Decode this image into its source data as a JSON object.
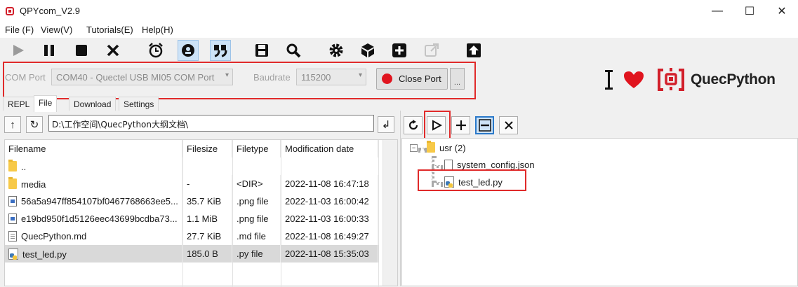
{
  "window": {
    "title": "QPYcom_V2.9",
    "minimize": "—",
    "maximize": "☐",
    "close": "✕"
  },
  "menu": [
    "File (F)",
    "View(V)",
    "Tutorials(E)",
    "Help(H)"
  ],
  "toolbar": {
    "icons": [
      "play-icon",
      "pause-icon",
      "stop-icon",
      "close-x-icon",
      "alarm-clock-icon",
      "record-icon",
      "quote-icon",
      "save-icon",
      "search-icon",
      "gear-icon",
      "cube-icon",
      "plus-box-icon",
      "external-link-icon",
      "upload-icon"
    ]
  },
  "connection": {
    "com_label": "COM Port",
    "com_value": "COM40 - Quectel USB MI05 COM Port",
    "baud_label": "Baudrate",
    "baud_value": "115200",
    "close_port": "Close Port",
    "more": "..."
  },
  "logo": {
    "text": "QuecPython",
    "accent": "#d21f2a"
  },
  "tabs": [
    "REPL",
    "File",
    "Download",
    "Settings"
  ],
  "active_tab": "File",
  "left": {
    "path": "D:\\工作空间\\QuecPython大纲文档\\",
    "enter_symbol": "↲",
    "columns": [
      "Filename",
      "Filesize",
      "Filetype",
      "Modification date"
    ],
    "rows": [
      {
        "icon": "folder",
        "name": "..",
        "size": "",
        "type": "",
        "date": ""
      },
      {
        "icon": "folder",
        "name": "media",
        "size": "-",
        "type": "<DIR>",
        "date": "2022-11-08 16:47:18"
      },
      {
        "icon": "img",
        "name": "56a5a947ff854107bf0467768663ee5...",
        "size": "35.7 KiB",
        "type": ".png file",
        "date": "2022-11-03 16:00:42"
      },
      {
        "icon": "img",
        "name": "e19bd950f1d5126eec43699bcdba73...",
        "size": "1.1 MiB",
        "type": ".png file",
        "date": "2022-11-03 16:00:33"
      },
      {
        "icon": "md",
        "name": "QuecPython.md",
        "size": "27.7 KiB",
        "type": ".md file",
        "date": "2022-11-08 16:49:27"
      },
      {
        "icon": "py",
        "name": "test_led.py",
        "size": "185.0 B",
        "type": ".py file",
        "date": "2022-11-08 15:35:03",
        "selected": true
      }
    ]
  },
  "right": {
    "tree_root": "usr (2)",
    "children": [
      "system_config.json",
      "test_led.py"
    ],
    "expander": "⊟"
  }
}
